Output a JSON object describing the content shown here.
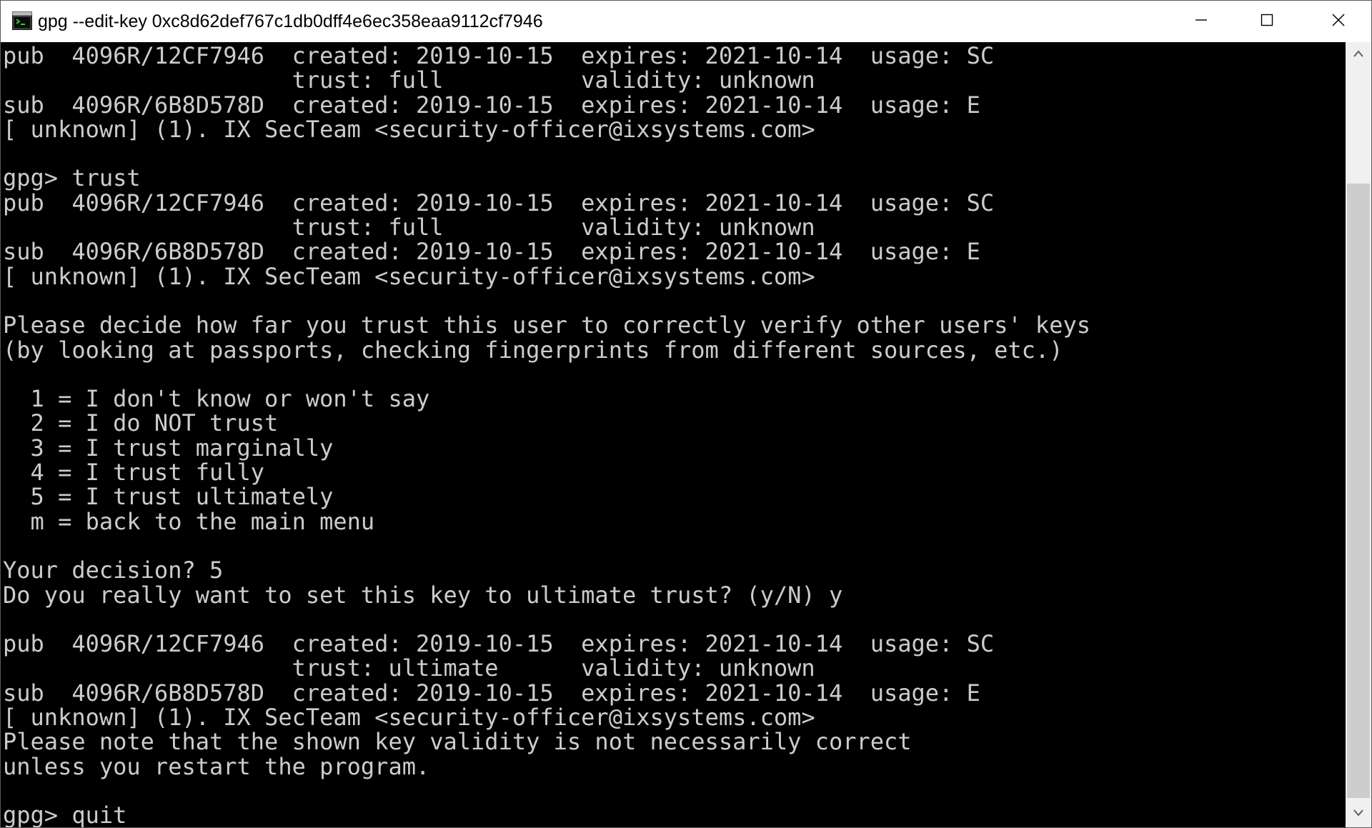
{
  "window": {
    "title": "gpg --edit-key 0xc8d62def767c1db0dff4e6ec358eaa9112cf7946",
    "icon": "console-icon",
    "controls": {
      "minimize": "minimize-icon",
      "maximize": "maximize-icon",
      "close": "close-icon"
    }
  },
  "console": {
    "lines": [
      "pub  4096R/12CF7946  created: 2019-10-15  expires: 2021-10-14  usage: SC",
      "                     trust: full          validity: unknown",
      "sub  4096R/6B8D578D  created: 2019-10-15  expires: 2021-10-14  usage: E",
      "[ unknown] (1). IX SecTeam <security-officer@ixsystems.com>",
      "",
      "gpg> trust",
      "pub  4096R/12CF7946  created: 2019-10-15  expires: 2021-10-14  usage: SC",
      "                     trust: full          validity: unknown",
      "sub  4096R/6B8D578D  created: 2019-10-15  expires: 2021-10-14  usage: E",
      "[ unknown] (1). IX SecTeam <security-officer@ixsystems.com>",
      "",
      "Please decide how far you trust this user to correctly verify other users' keys",
      "(by looking at passports, checking fingerprints from different sources, etc.)",
      "",
      "  1 = I don't know or won't say",
      "  2 = I do NOT trust",
      "  3 = I trust marginally",
      "  4 = I trust fully",
      "  5 = I trust ultimately",
      "  m = back to the main menu",
      "",
      "Your decision? 5",
      "Do you really want to set this key to ultimate trust? (y/N) y",
      "",
      "pub  4096R/12CF7946  created: 2019-10-15  expires: 2021-10-14  usage: SC",
      "                     trust: ultimate      validity: unknown",
      "sub  4096R/6B8D578D  created: 2019-10-15  expires: 2021-10-14  usage: E",
      "[ unknown] (1). IX SecTeam <security-officer@ixsystems.com>",
      "Please note that the shown key validity is not necessarily correct",
      "unless you restart the program.",
      "",
      "gpg> quit"
    ]
  },
  "scrollbar": {
    "up_icon": "scroll-up-arrow-icon",
    "down_icon": "scroll-down-arrow-icon"
  },
  "colors": {
    "console_background": "#000000",
    "console_text": "#cccccc",
    "titlebar_background": "#ffffff",
    "scrollbar_track": "#f0f0f0",
    "scrollbar_thumb": "#cdcdcd"
  }
}
